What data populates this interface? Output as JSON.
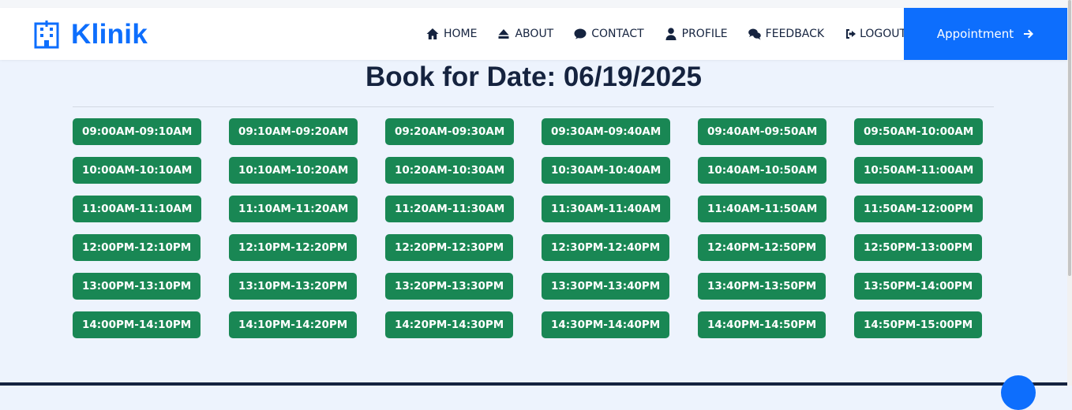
{
  "brand": {
    "name": "Klinik",
    "icon": "hospital-icon"
  },
  "nav": {
    "items": [
      {
        "label": "HOME",
        "icon": "home-icon"
      },
      {
        "label": "ABOUT",
        "icon": "eject-icon"
      },
      {
        "label": "CONTACT",
        "icon": "comment-icon"
      },
      {
        "label": "PROFILE",
        "icon": "user-icon"
      },
      {
        "label": "FEEDBACK",
        "icon": "comments-icon"
      },
      {
        "label": "LOGOUT",
        "icon": "sign-out-icon"
      }
    ],
    "appointment": {
      "label": "Appointment",
      "icon": "arrow-right-icon"
    }
  },
  "page": {
    "title": "Book for Date: 06/19/2025"
  },
  "colors": {
    "primary": "#0d6efd",
    "slot": "#198754",
    "text": "#15233f",
    "background": "#edf3fd"
  },
  "slots": [
    "09:00AM-09:10AM",
    "09:10AM-09:20AM",
    "09:20AM-09:30AM",
    "09:30AM-09:40AM",
    "09:40AM-09:50AM",
    "09:50AM-10:00AM",
    "10:00AM-10:10AM",
    "10:10AM-10:20AM",
    "10:20AM-10:30AM",
    "10:30AM-10:40AM",
    "10:40AM-10:50AM",
    "10:50AM-11:00AM",
    "11:00AM-11:10AM",
    "11:10AM-11:20AM",
    "11:20AM-11:30AM",
    "11:30AM-11:40AM",
    "11:40AM-11:50AM",
    "11:50AM-12:00PM",
    "12:00PM-12:10PM",
    "12:10PM-12:20PM",
    "12:20PM-12:30PM",
    "12:30PM-12:40PM",
    "12:40PM-12:50PM",
    "12:50PM-13:00PM",
    "13:00PM-13:10PM",
    "13:10PM-13:20PM",
    "13:20PM-13:30PM",
    "13:30PM-13:40PM",
    "13:40PM-13:50PM",
    "13:50PM-14:00PM",
    "14:00PM-14:10PM",
    "14:10PM-14:20PM",
    "14:20PM-14:30PM",
    "14:30PM-14:40PM",
    "14:40PM-14:50PM",
    "14:50PM-15:00PM"
  ]
}
